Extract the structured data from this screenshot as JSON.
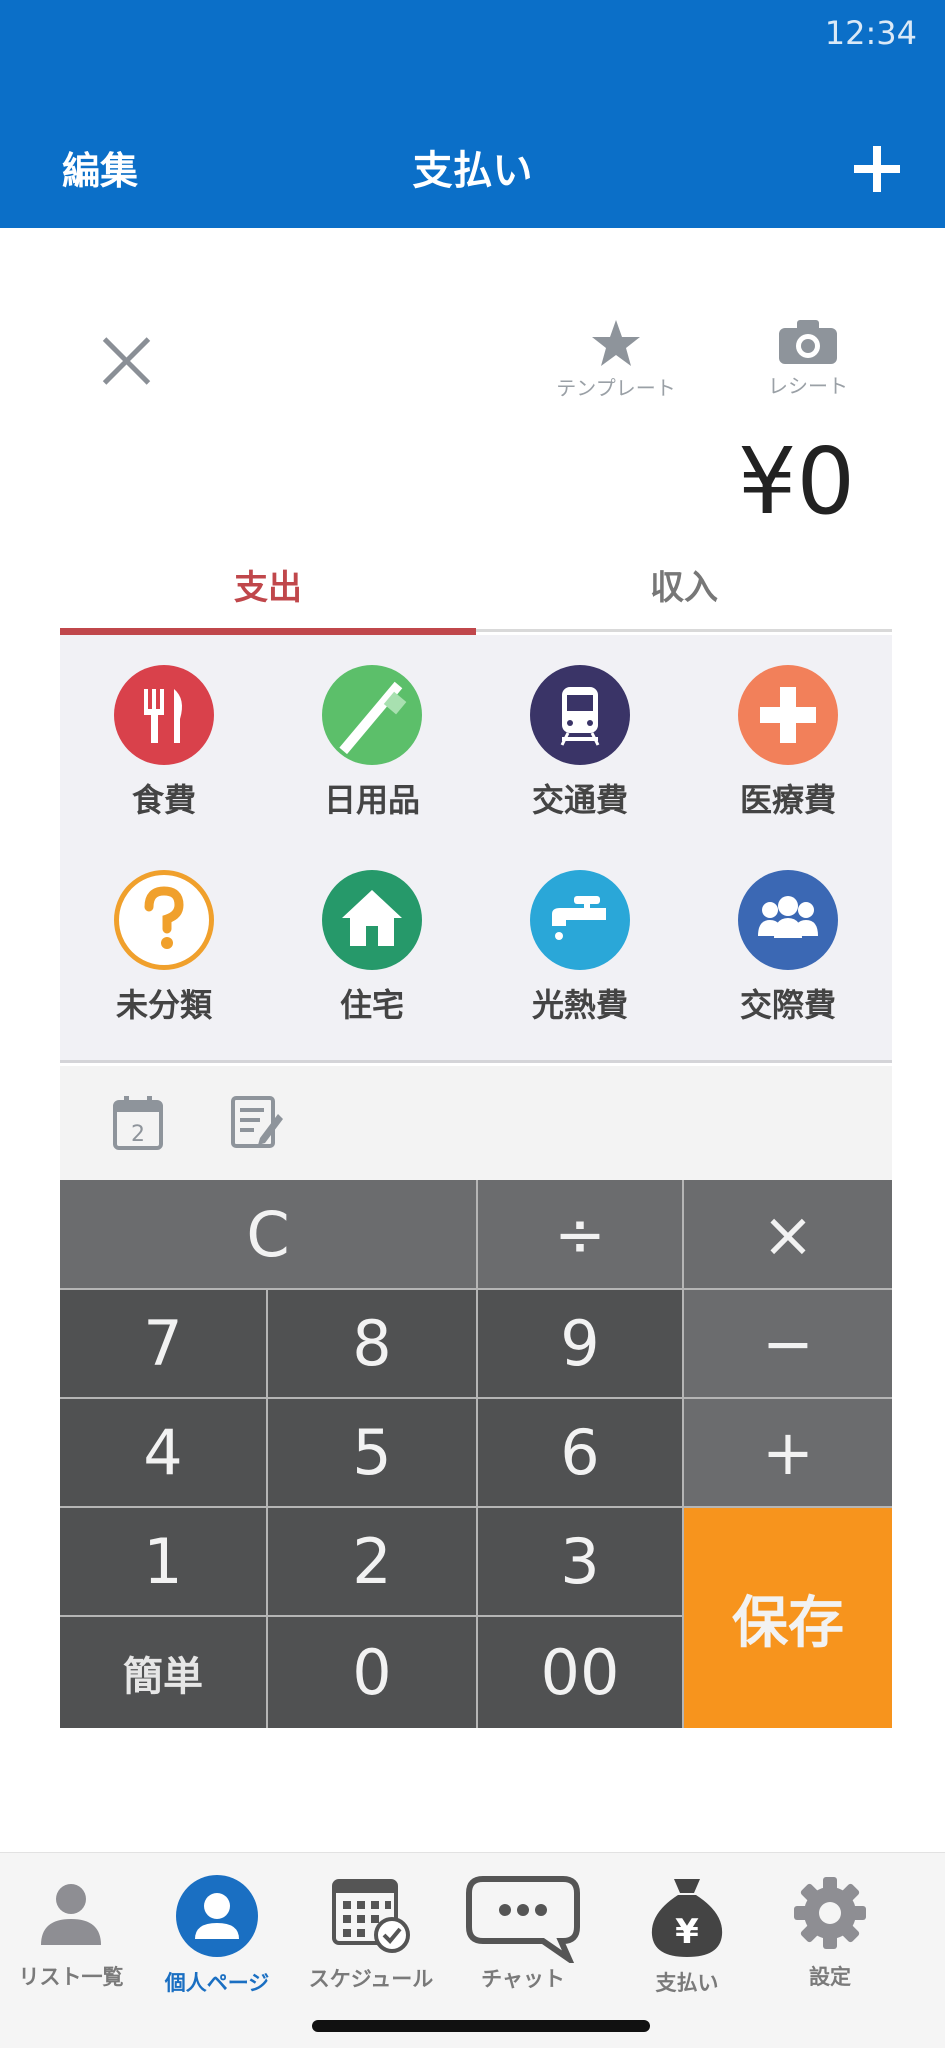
{
  "status": {
    "time": "12:34"
  },
  "header": {
    "edit_label": "編集",
    "title": "支払い",
    "add_icon": "plus-icon"
  },
  "entry": {
    "close_icon": "close-icon",
    "template_label": "テンプレート",
    "receipt_label": "レシート",
    "amount": "¥0"
  },
  "tabs": {
    "expense": "支出",
    "income": "収入",
    "active": "expense",
    "active_color": "#c0474b"
  },
  "categories": [
    {
      "label": "食費",
      "icon": "cutlery-icon",
      "color": "#d9414b"
    },
    {
      "label": "日用品",
      "icon": "toothbrush-icon",
      "color": "#5cbf6a"
    },
    {
      "label": "交通費",
      "icon": "train-icon",
      "color": "#3a3467"
    },
    {
      "label": "医療費",
      "icon": "medical-cross-icon",
      "color": "#f2805a"
    },
    {
      "label": "未分類",
      "icon": "question-icon",
      "color": "#f0a02c"
    },
    {
      "label": "住宅",
      "icon": "house-icon",
      "color": "#26996a"
    },
    {
      "label": "光熱費",
      "icon": "faucet-icon",
      "color": "#2aa7d8"
    },
    {
      "label": "交際費",
      "icon": "people-icon",
      "color": "#3b68b4"
    }
  ],
  "tools": {
    "date_icon": "calendar-icon",
    "date_value": "2",
    "memo_icon": "memo-icon"
  },
  "keypad": {
    "clear": "C",
    "divide": "÷",
    "multiply": "×",
    "minus": "−",
    "plus": "+",
    "seven": "7",
    "eight": "8",
    "nine": "9",
    "four": "4",
    "five": "5",
    "six": "6",
    "one": "1",
    "two": "2",
    "three": "3",
    "simple": "簡単",
    "zero": "0",
    "double_zero": "00",
    "save": "保存"
  },
  "tabbar": {
    "items": [
      {
        "label": "リスト一覧",
        "icon": "person-icon"
      },
      {
        "label": "個人ページ",
        "icon": "profile-icon"
      },
      {
        "label": "スケジュール",
        "icon": "calendar-check-icon"
      },
      {
        "label": "チャット",
        "icon": "chat-bubble-icon"
      },
      {
        "label": "支払い",
        "icon": "yen-bag-icon"
      },
      {
        "label": "設定",
        "icon": "gear-icon"
      }
    ],
    "active_index": 1,
    "active_color": "#1a6fc2"
  }
}
